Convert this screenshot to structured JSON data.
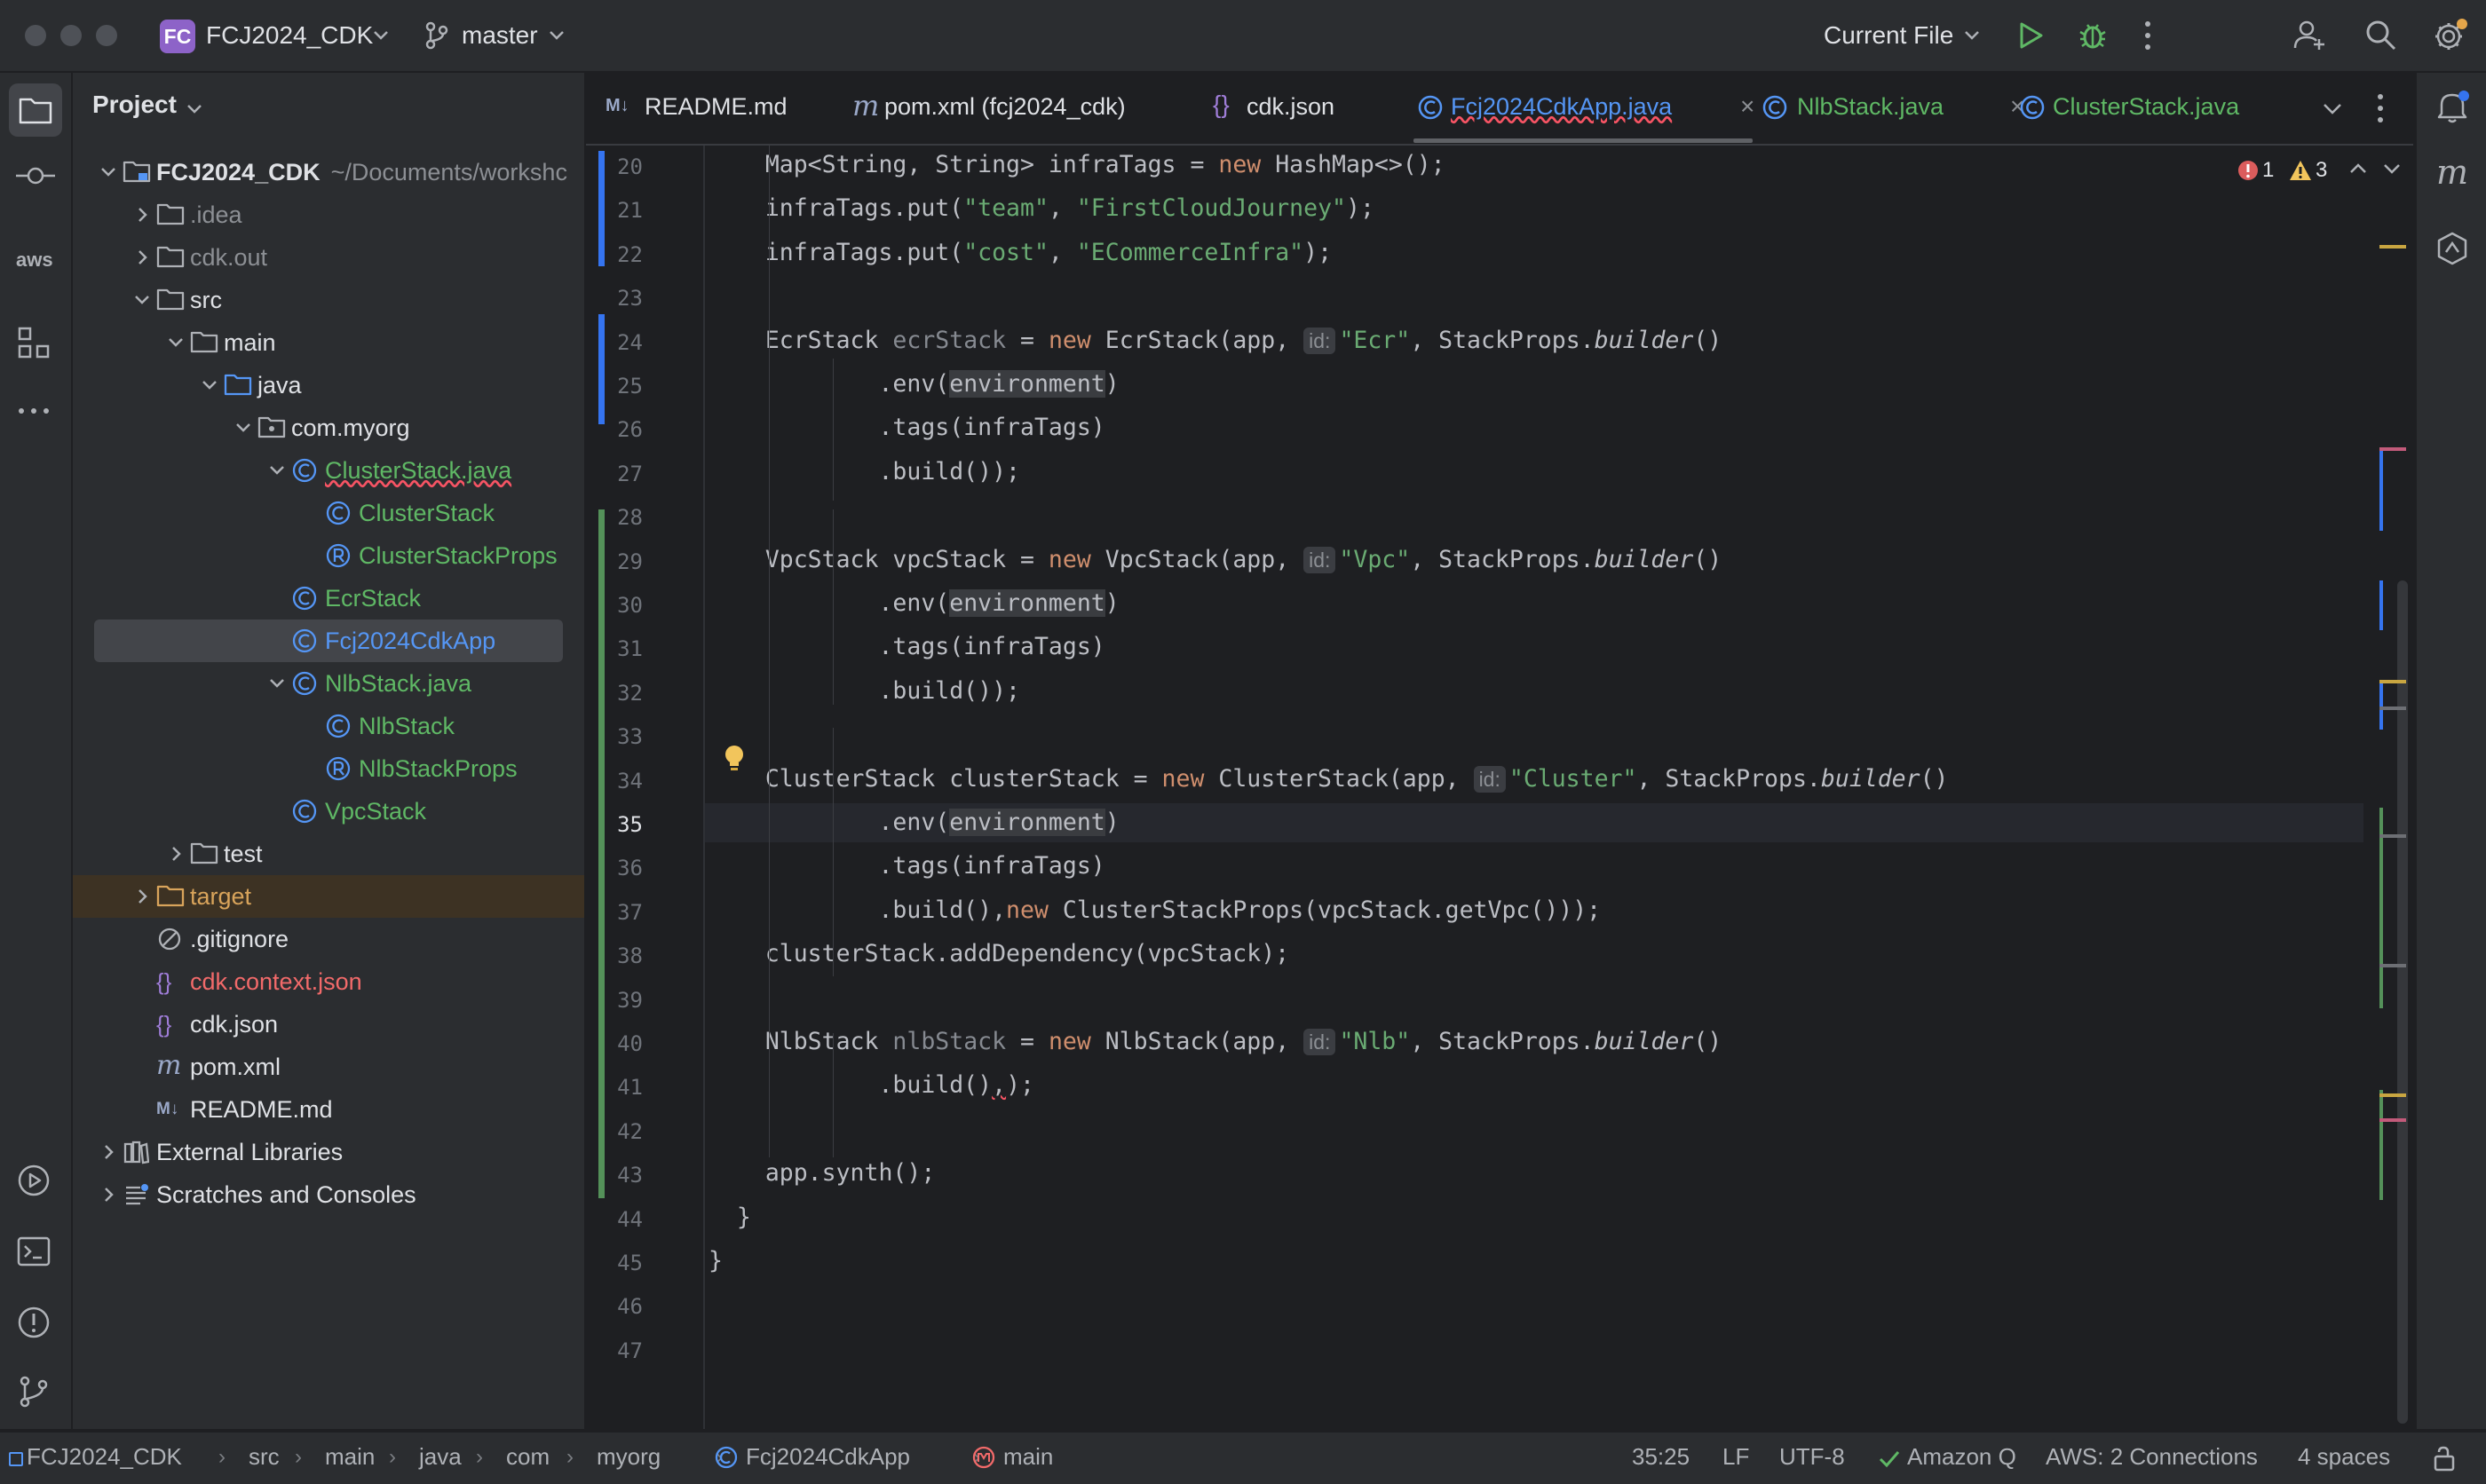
{
  "window": {
    "project_badge": "FC",
    "project_name": "FCJ2024_CDK",
    "branch": "master",
    "run_config": "Current File"
  },
  "project_panel": {
    "title": "Project",
    "tree": [
      {
        "label": "FCJ2024_CDK",
        "suffix": "~/Documents/workshc",
        "icon": "module-folder-icon",
        "color": "white",
        "bold": true,
        "depth": 0,
        "arrow": "expanded"
      },
      {
        "label": ".idea",
        "icon": "folder-icon",
        "color": "grey",
        "depth": 1,
        "arrow": "collapsed"
      },
      {
        "label": "cdk.out",
        "icon": "folder-icon",
        "color": "grey",
        "depth": 1,
        "arrow": "collapsed"
      },
      {
        "label": "src",
        "icon": "folder-icon",
        "color": "white",
        "depth": 1,
        "arrow": "expanded"
      },
      {
        "label": "main",
        "icon": "folder-icon",
        "color": "white",
        "depth": 2,
        "arrow": "expanded"
      },
      {
        "label": "java",
        "icon": "source-folder-icon",
        "color": "white",
        "depth": 3,
        "arrow": "expanded"
      },
      {
        "label": "com.myorg",
        "icon": "package-icon",
        "color": "white",
        "depth": 4,
        "arrow": "expanded"
      },
      {
        "label": "ClusterStack.java",
        "icon": "class-icon",
        "color": "green",
        "depth": 5,
        "arrow": "expanded"
      },
      {
        "label": "ClusterStack",
        "icon": "class-icon",
        "color": "green",
        "depth": 6,
        "arrow": "none"
      },
      {
        "label": "ClusterStackProps",
        "icon": "record-icon",
        "color": "green",
        "depth": 6,
        "arrow": "none"
      },
      {
        "label": "EcrStack",
        "icon": "class-icon",
        "color": "green",
        "depth": 5,
        "arrow": "none"
      },
      {
        "label": "Fcj2024CdkApp",
        "icon": "class-icon",
        "color": "blue",
        "depth": 5,
        "arrow": "none",
        "selected": true
      },
      {
        "label": "NlbStack.java",
        "icon": "class-icon",
        "color": "green",
        "depth": 5,
        "arrow": "expanded"
      },
      {
        "label": "NlbStack",
        "icon": "class-icon",
        "color": "green",
        "depth": 6,
        "arrow": "none"
      },
      {
        "label": "NlbStackProps",
        "icon": "record-icon",
        "color": "green",
        "depth": 6,
        "arrow": "none"
      },
      {
        "label": "VpcStack",
        "icon": "class-icon",
        "color": "green",
        "depth": 5,
        "arrow": "none"
      },
      {
        "label": "test",
        "icon": "folder-icon",
        "color": "white",
        "depth": 2,
        "arrow": "collapsed"
      },
      {
        "label": "target",
        "icon": "excluded-folder-icon",
        "color": "orange",
        "depth": 1,
        "arrow": "collapsed",
        "excluded": true
      },
      {
        "label": ".gitignore",
        "icon": "ignore-file-icon",
        "color": "white",
        "depth": 1,
        "arrow": "none"
      },
      {
        "label": "cdk.context.json",
        "icon": "json-icon",
        "color": "red",
        "depth": 1,
        "arrow": "none"
      },
      {
        "label": "cdk.json",
        "icon": "json-icon",
        "color": "white",
        "depth": 1,
        "arrow": "none"
      },
      {
        "label": "pom.xml",
        "icon": "maven-icon",
        "color": "white",
        "depth": 1,
        "arrow": "none"
      },
      {
        "label": "README.md",
        "icon": "markdown-icon",
        "color": "white",
        "depth": 1,
        "arrow": "none"
      },
      {
        "label": "External Libraries",
        "icon": "libraries-icon",
        "color": "white",
        "depth": 0,
        "arrow": "collapsed"
      },
      {
        "label": "Scratches and Consoles",
        "icon": "scratches-icon",
        "color": "white",
        "depth": 0,
        "arrow": "collapsed"
      }
    ]
  },
  "tabs": [
    {
      "label": "README.md",
      "icon": "markdown-icon",
      "color": "#dfe1e5"
    },
    {
      "label": "pom.xml (fcj2024_cdk)",
      "icon": "maven-icon",
      "color": "#dfe1e5"
    },
    {
      "label": "cdk.json",
      "icon": "json-icon",
      "color": "#dfe1e5"
    },
    {
      "label": "Fcj2024CdkApp.java",
      "icon": "class-icon",
      "color": "#5596f5",
      "active": true,
      "closable": true
    },
    {
      "label": "NlbStack.java",
      "icon": "class-icon",
      "color": "#5fb865",
      "closable": true
    },
    {
      "label": "ClusterStack.java",
      "icon": "class-icon",
      "color": "#5fb865"
    }
  ],
  "editor": {
    "inspections": {
      "errors": "1",
      "warnings": "3"
    },
    "current_line": 35,
    "line_numbers": [
      "20",
      "21",
      "22",
      "23",
      "24",
      "25",
      "26",
      "27",
      "28",
      "29",
      "30",
      "31",
      "32",
      "33",
      "34",
      "35",
      "36",
      "37",
      "38",
      "39",
      "40",
      "41",
      "42",
      "43",
      "44",
      "45",
      "46",
      "47"
    ],
    "code_lines": [
      [
        {
          "t": "    Map<String, String> infraTags = "
        },
        {
          "t": "new",
          "c": "kw"
        },
        {
          "t": " HashMap<>();"
        }
      ],
      [
        {
          "t": "    infraTags.put("
        },
        {
          "t": "\"team\"",
          "c": "str"
        },
        {
          "t": ", "
        },
        {
          "t": "\"FirstCloudJourney\"",
          "c": "str"
        },
        {
          "t": ");"
        }
      ],
      [
        {
          "t": "    infraTags.put("
        },
        {
          "t": "\"cost\"",
          "c": "str"
        },
        {
          "t": ", "
        },
        {
          "t": "\"ECommerceInfra\"",
          "c": "str"
        },
        {
          "t": ");"
        }
      ],
      [],
      [
        {
          "t": "    EcrStack "
        },
        {
          "t": "ecrStack",
          "c": "grey"
        },
        {
          "t": " = "
        },
        {
          "t": "new",
          "c": "kw"
        },
        {
          "t": " EcrStack(app, "
        },
        {
          "t": "id:",
          "c": "hint"
        },
        {
          "t": "\"Ecr\"",
          "c": "str"
        },
        {
          "t": ", StackProps."
        },
        {
          "t": "builder",
          "c": "ital"
        },
        {
          "t": "()"
        }
      ],
      [
        {
          "t": "            .env("
        },
        {
          "t": "environment",
          "c": "hl"
        },
        {
          "t": ")"
        }
      ],
      [
        {
          "t": "            .tags(infraTags)"
        }
      ],
      [
        {
          "t": "            .build());"
        }
      ],
      [],
      [
        {
          "t": "    VpcStack vpcStack = "
        },
        {
          "t": "new",
          "c": "kw"
        },
        {
          "t": " VpcStack(app, "
        },
        {
          "t": "id:",
          "c": "hint"
        },
        {
          "t": "\"Vpc\"",
          "c": "str"
        },
        {
          "t": ", StackProps."
        },
        {
          "t": "builder",
          "c": "ital"
        },
        {
          "t": "()"
        }
      ],
      [
        {
          "t": "            .env("
        },
        {
          "t": "environment",
          "c": "hl"
        },
        {
          "t": ")"
        }
      ],
      [
        {
          "t": "            .tags(infraTags)"
        }
      ],
      [
        {
          "t": "            .build());"
        }
      ],
      [],
      [
        {
          "t": "    ClusterStack clusterStack = "
        },
        {
          "t": "new",
          "c": "kw"
        },
        {
          "t": " ClusterStack(app, "
        },
        {
          "t": "id:",
          "c": "hint"
        },
        {
          "t": "\"Cluster\"",
          "c": "str"
        },
        {
          "t": ", StackProps."
        },
        {
          "t": "builder",
          "c": "ital"
        },
        {
          "t": "()"
        }
      ],
      [
        {
          "t": "            .env("
        },
        {
          "t": "environment",
          "c": "hl"
        },
        {
          "t": ")"
        }
      ],
      [
        {
          "t": "            .tags(infraTags)"
        }
      ],
      [
        {
          "t": "            .build(),"
        },
        {
          "t": "new",
          "c": "kw"
        },
        {
          "t": " ClusterStackProps(vpcStack.getVpc()));"
        }
      ],
      [
        {
          "t": "    clusterStack.addDependency(vpcStack);"
        }
      ],
      [],
      [
        {
          "t": "    NlbStack "
        },
        {
          "t": "nlbStack",
          "c": "grey"
        },
        {
          "t": " = "
        },
        {
          "t": "new",
          "c": "kw"
        },
        {
          "t": " NlbStack(app, "
        },
        {
          "t": "id:",
          "c": "hint"
        },
        {
          "t": "\"Nlb\"",
          "c": "str"
        },
        {
          "t": ", StackProps."
        },
        {
          "t": "builder",
          "c": "ital"
        },
        {
          "t": "()"
        }
      ],
      [
        {
          "t": "            .build()"
        },
        {
          "t": ",",
          "c": "wavy"
        },
        {
          "t": ");"
        }
      ],
      [],
      [
        {
          "t": "    app.synth();"
        }
      ],
      [
        {
          "t": "  }"
        }
      ],
      [
        {
          "t": "}"
        }
      ],
      [],
      []
    ]
  },
  "status_bar": {
    "breadcrumbs": [
      "FCJ2024_CDK",
      "src",
      "main",
      "java",
      "com",
      "myorg",
      "Fcj2024CdkApp",
      "main"
    ],
    "position": "35:25",
    "line_ending": "LF",
    "encoding": "UTF-8",
    "amazon_q": "Amazon Q",
    "aws": "AWS: 2 Connections",
    "indent": "4 spaces"
  }
}
